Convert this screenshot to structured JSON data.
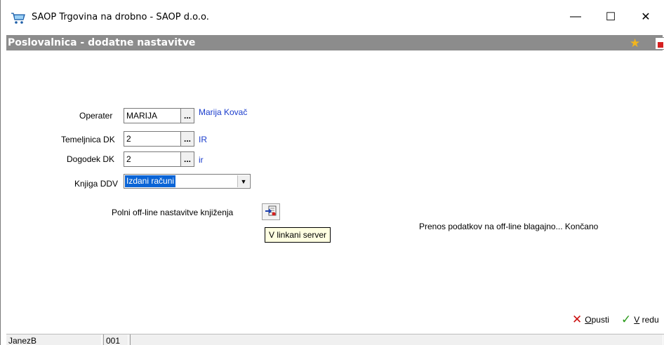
{
  "window": {
    "title": "SAOP Trgovina na drobno - SAOP d.o.o.",
    "minimize_glyph": "—",
    "maximize_glyph": "☐",
    "close_glyph": "✕"
  },
  "form": {
    "caption": "Poslovalnica - dodatne nastavitve",
    "favorite_icon": "star-icon",
    "close_form_icon": "document-close-icon"
  },
  "fields": {
    "operater": {
      "label": "Operater",
      "value": "MARIJA",
      "lookup": "...",
      "description": "Marija Kovač"
    },
    "temeljnica": {
      "label": "Temeljnica DK",
      "value": "2",
      "lookup": "...",
      "description": "IR"
    },
    "dogodek": {
      "label": "Dogodek DK",
      "value": "2",
      "lookup": "...",
      "description": "ir"
    },
    "knjiga": {
      "label": "Knjiga DDV",
      "value": "Izdani računi",
      "arrow": "▼"
    }
  },
  "offline": {
    "label": "Polni off-line nastavitve knjiženja",
    "tooltip": "V linkani server"
  },
  "status_message": "Prenos podatkov na off-line blagajno... Končano",
  "actions": {
    "cancel_first": "O",
    "cancel_rest": "pusti",
    "cancel_icon": "✕",
    "ok_first": "V",
    "ok_rest": " redu",
    "ok_icon": "✓"
  },
  "statusbar": {
    "user": "JanezB",
    "code": "001",
    "extra": ""
  },
  "colors": {
    "caption_bg": "#8c8c8c",
    "link": "#1a3ccc",
    "selection": "#0a64d6",
    "cancel": "#cc1111",
    "ok": "#2a9a1a",
    "star": "#f2b51c"
  }
}
